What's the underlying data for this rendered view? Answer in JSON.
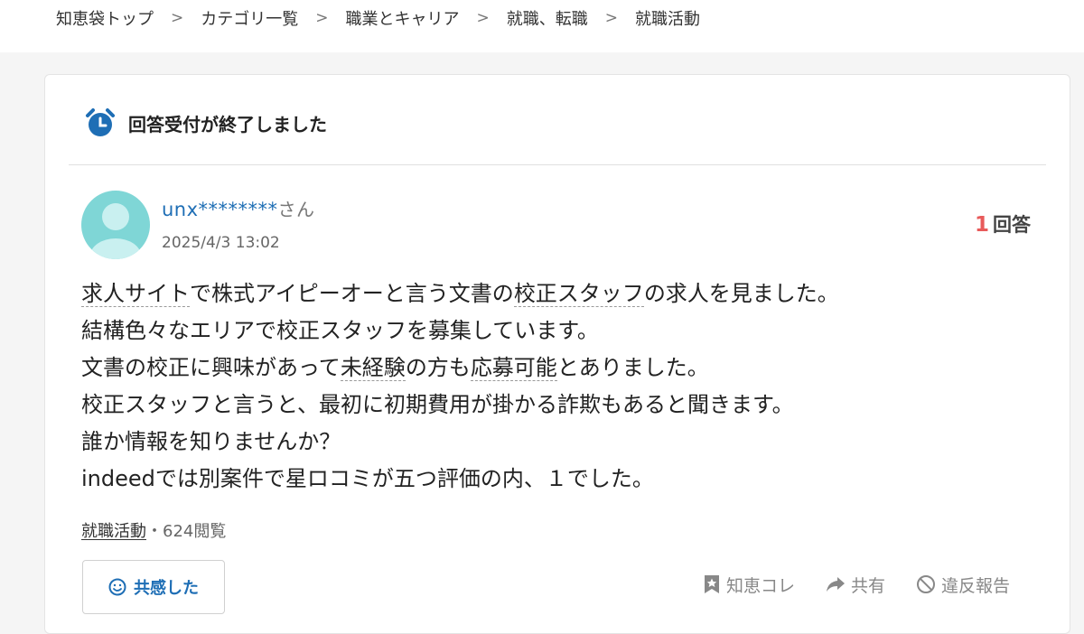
{
  "breadcrumb": {
    "items": [
      "知恵袋トップ",
      "カテゴリ一覧",
      "職業とキャリア",
      "就職、転職",
      "就職活動"
    ],
    "separator": ">"
  },
  "status": {
    "closed_text": "回答受付が終了しました"
  },
  "question": {
    "username": "unx********",
    "honorific": "さん",
    "date": "2025/4/3 13:02",
    "answer_count": "1",
    "answer_label": "回答",
    "body_lines": [
      [
        "求人サイト",
        "で株式アイピーオーと言う文書の",
        "校正スタッフ",
        "の求人を見ました。"
      ],
      [
        "結構色々なエリアで校正スタッフを募集しています。"
      ],
      [
        "文書の校正に興味があって",
        "未経験",
        "の方も",
        "応募可能",
        "とありました。"
      ],
      [
        "校正スタッフと言うと、最初に初期費用が掛かる詐欺もあると聞きます。"
      ],
      [
        "誰か情報を知りませんか？"
      ],
      [
        "indeedでは別案件で星ロコミが五つ評価の内、１でした。"
      ]
    ],
    "category_tag": "就職活動",
    "views": "・624閲覧"
  },
  "actions": {
    "empathy_label": "共感した",
    "chiekore_label": "知恵コレ",
    "share_label": "共有",
    "report_label": "違反報告"
  },
  "colors": {
    "accent_blue": "#1e6eb5",
    "answer_red": "#e85a5a",
    "avatar_bg": "#7fd6d6"
  }
}
